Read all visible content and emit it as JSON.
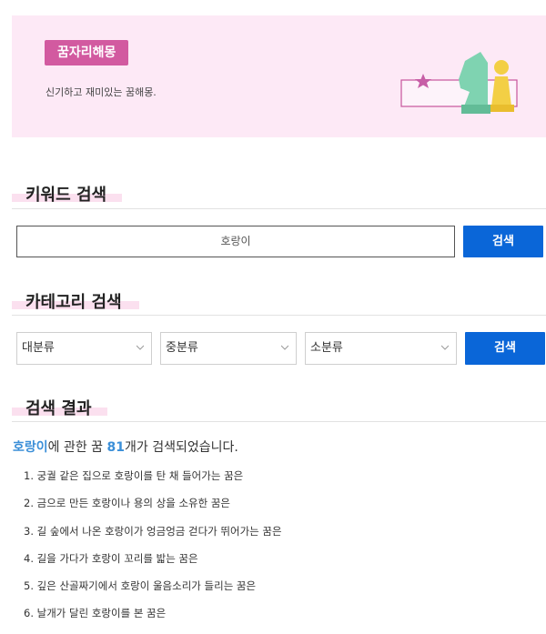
{
  "banner": {
    "badge": "꿈자리해몽",
    "subtitle": "신기하고 재미있는 꿈해몽.",
    "colors": {
      "bg": "#fde9f6",
      "badge": "#d25aa0"
    }
  },
  "keyword_search": {
    "title": "키워드 검색",
    "input_value": "호랑이",
    "button_label": "검색"
  },
  "category_search": {
    "title": "카테고리 검색",
    "selects": [
      "대분류",
      "중분류",
      "소분류"
    ],
    "button_label": "검색"
  },
  "results": {
    "title": "검색 결과",
    "keyword": "호랑이",
    "summary_mid": "에 관한 꿈 ",
    "count": "81",
    "summary_end": "개가 검색되었습니다.",
    "items": [
      "1. 궁궐 같은 집으로 호랑이를 탄 채 들어가는 꿈은",
      "2. 금으로 만든 호랑이나 용의 상을 소유한 꿈은",
      "3. 길 숲에서 나온 호랑이가 엉금엉금 걷다가 뛰어가는 꿈은",
      "4. 길을 가다가 호랑이 꼬리를 밟는 꿈은",
      "5. 깊은 산골짜기에서 호랑이 울음소리가 들리는 꿈은",
      "6. 날개가 달린 호랑이를 본 꿈은"
    ]
  },
  "colors": {
    "accent": "#0a66d8",
    "highlight": "#3b8fd8",
    "title_underline": "#fbe0ef"
  }
}
